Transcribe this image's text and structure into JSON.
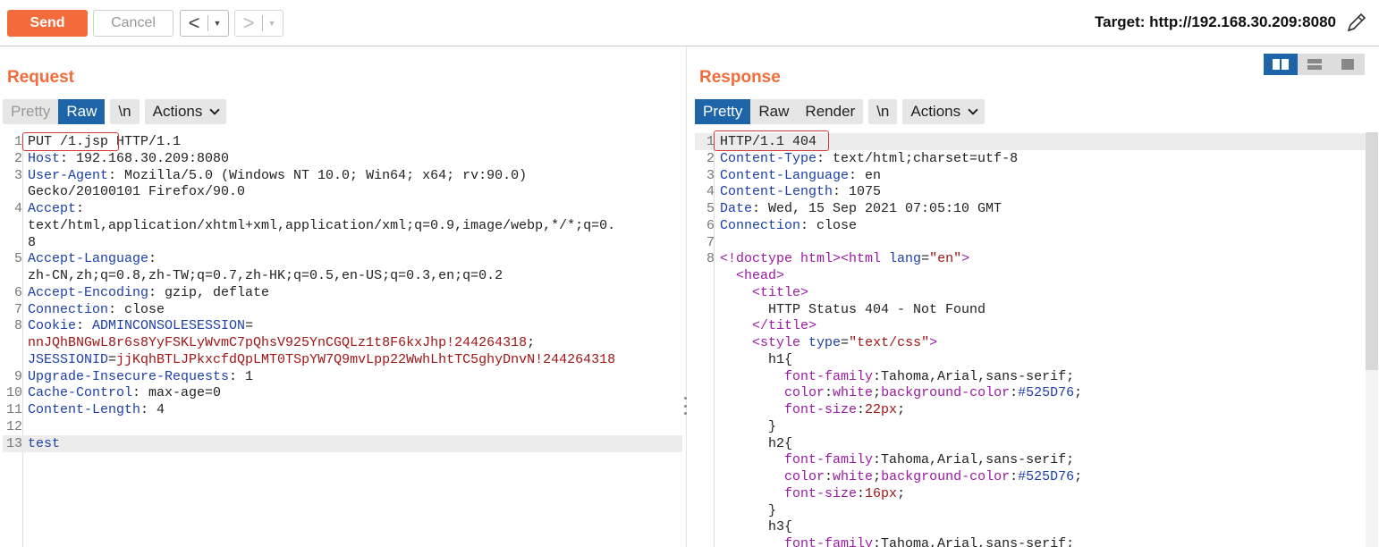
{
  "toolbar": {
    "send_label": "Send",
    "cancel_label": "Cancel",
    "back_glyph": "<",
    "forward_glyph": ">",
    "target_label": "Target: http://192.168.30.209:8080",
    "edit_icon": "pencil-icon"
  },
  "request": {
    "title": "Request",
    "view_tabs": [
      "Pretty",
      "Raw"
    ],
    "active_view": "Raw",
    "newline_toggle": "\\n",
    "actions_label": "Actions",
    "lines": [
      {
        "n": "1",
        "parts": [
          [
            "v",
            "PUT /1.jsp"
          ],
          [
            "v",
            " HTTP/1.1"
          ]
        ]
      },
      {
        "n": "2",
        "parts": [
          [
            "k",
            "Host"
          ],
          [
            "v",
            ": 192.168.30.209:8080"
          ]
        ]
      },
      {
        "n": "3",
        "parts": [
          [
            "k",
            "User-Agent"
          ],
          [
            "v",
            ": Mozilla/5.0 (Windows NT 10.0; Win64; x64; rv:90.0)"
          ]
        ]
      },
      {
        "n": "",
        "parts": [
          [
            "v",
            "Gecko/20100101 Firefox/90.0"
          ]
        ]
      },
      {
        "n": "4",
        "parts": [
          [
            "k",
            "Accept"
          ],
          [
            "v",
            ":"
          ]
        ]
      },
      {
        "n": "",
        "parts": [
          [
            "v",
            "text/html,application/xhtml+xml,application/xml;q=0.9,image/webp,*/*;q=0."
          ]
        ]
      },
      {
        "n": "",
        "parts": [
          [
            "v",
            "8"
          ]
        ]
      },
      {
        "n": "5",
        "parts": [
          [
            "k",
            "Accept-Language"
          ],
          [
            "v",
            ":"
          ]
        ]
      },
      {
        "n": "",
        "parts": [
          [
            "v",
            "zh-CN,zh;q=0.8,zh-TW;q=0.7,zh-HK;q=0.5,en-US;q=0.3,en;q=0.2"
          ]
        ]
      },
      {
        "n": "6",
        "parts": [
          [
            "k",
            "Accept-Encoding"
          ],
          [
            "v",
            ": gzip, deflate"
          ]
        ]
      },
      {
        "n": "7",
        "parts": [
          [
            "k",
            "Connection"
          ],
          [
            "v",
            ": close"
          ]
        ]
      },
      {
        "n": "8",
        "parts": [
          [
            "k",
            "Cookie"
          ],
          [
            "v",
            ": "
          ],
          [
            "k",
            "ADMINCONSOLESESSION"
          ],
          [
            "v",
            "="
          ]
        ]
      },
      {
        "n": "",
        "parts": [
          [
            "r",
            "nnJQhBNGwL8r6s8YyFSKLyWvmC7pQhsV925YnCGQLz1t8F6kxJhp!244264318"
          ],
          [
            "v",
            ";"
          ]
        ]
      },
      {
        "n": "",
        "parts": [
          [
            "k",
            "JSESSIONID"
          ],
          [
            "v",
            "="
          ],
          [
            "r",
            "jjKqhBTLJPkxcfdQpLMT0TSpYW7Q9mvLpp22WwhLhtTC5ghyDnvN!244264318"
          ]
        ]
      },
      {
        "n": "9",
        "parts": [
          [
            "k",
            "Upgrade-Insecure-Requests"
          ],
          [
            "v",
            ": 1"
          ]
        ]
      },
      {
        "n": "10",
        "parts": [
          [
            "k",
            "Cache-Control"
          ],
          [
            "v",
            ": max-age=0"
          ]
        ]
      },
      {
        "n": "11",
        "parts": [
          [
            "k",
            "Content-Length"
          ],
          [
            "v",
            ": 4"
          ]
        ]
      },
      {
        "n": "12",
        "parts": []
      },
      {
        "n": "13",
        "parts": [
          [
            "k",
            "test"
          ]
        ],
        "highlight": true
      }
    ]
  },
  "response": {
    "title": "Response",
    "view_tabs": [
      "Pretty",
      "Raw",
      "Render"
    ],
    "active_view": "Pretty",
    "newline_toggle": "\\n",
    "actions_label": "Actions",
    "lines": [
      {
        "n": "1",
        "parts": [
          [
            "v",
            "HTTP/1.1 404"
          ]
        ],
        "highlight": true
      },
      {
        "n": "2",
        "parts": [
          [
            "k",
            "Content-Type"
          ],
          [
            "v",
            ": text/html;charset=utf-8"
          ]
        ]
      },
      {
        "n": "3",
        "parts": [
          [
            "k",
            "Content-Language"
          ],
          [
            "v",
            ": en"
          ]
        ]
      },
      {
        "n": "4",
        "parts": [
          [
            "k",
            "Content-Length"
          ],
          [
            "v",
            ": 1075"
          ]
        ]
      },
      {
        "n": "5",
        "parts": [
          [
            "k",
            "Date"
          ],
          [
            "v",
            ": Wed, 15 Sep 2021 07:05:10 GMT"
          ]
        ]
      },
      {
        "n": "6",
        "parts": [
          [
            "k",
            "Connection"
          ],
          [
            "v",
            ": close"
          ]
        ]
      },
      {
        "n": "7",
        "parts": []
      },
      {
        "n": "8",
        "parts": [
          [
            "pu",
            "<!doctype html>"
          ],
          [
            "pu",
            "<html "
          ],
          [
            "k",
            "lang"
          ],
          [
            "v",
            "="
          ],
          [
            "r",
            "\"en\""
          ],
          [
            "pu",
            ">"
          ]
        ]
      },
      {
        "n": "",
        "parts": [
          [
            "v",
            "  "
          ],
          [
            "pu",
            "<head>"
          ]
        ]
      },
      {
        "n": "",
        "parts": [
          [
            "v",
            "    "
          ],
          [
            "pu",
            "<title>"
          ]
        ]
      },
      {
        "n": "",
        "parts": [
          [
            "v",
            "      HTTP Status 404 - Not Found"
          ]
        ]
      },
      {
        "n": "",
        "parts": [
          [
            "v",
            "    "
          ],
          [
            "pu",
            "</title>"
          ]
        ]
      },
      {
        "n": "",
        "parts": [
          [
            "v",
            "    "
          ],
          [
            "pu",
            "<style "
          ],
          [
            "k",
            "type"
          ],
          [
            "v",
            "="
          ],
          [
            "r",
            "\"text/css\""
          ],
          [
            "pu",
            ">"
          ]
        ]
      },
      {
        "n": "",
        "parts": [
          [
            "v",
            "      h1{"
          ]
        ]
      },
      {
        "n": "",
        "parts": [
          [
            "v",
            "        "
          ],
          [
            "pu",
            "font-family"
          ],
          [
            "v",
            ":Tahoma,Arial,sans-serif;"
          ]
        ]
      },
      {
        "n": "",
        "parts": [
          [
            "v",
            "        "
          ],
          [
            "pu",
            "color"
          ],
          [
            "v",
            ":"
          ],
          [
            "pu",
            "white"
          ],
          [
            "v",
            ";"
          ],
          [
            "pu",
            "background-color"
          ],
          [
            "v",
            ":"
          ],
          [
            "k",
            "#525D76"
          ],
          [
            "v",
            ";"
          ]
        ]
      },
      {
        "n": "",
        "parts": [
          [
            "v",
            "        "
          ],
          [
            "pu",
            "font-size"
          ],
          [
            "v",
            ":"
          ],
          [
            "r",
            "22px"
          ],
          [
            "v",
            ";"
          ]
        ]
      },
      {
        "n": "",
        "parts": [
          [
            "v",
            "      }"
          ]
        ]
      },
      {
        "n": "",
        "parts": [
          [
            "v",
            "      h2{"
          ]
        ]
      },
      {
        "n": "",
        "parts": [
          [
            "v",
            "        "
          ],
          [
            "pu",
            "font-family"
          ],
          [
            "v",
            ":Tahoma,Arial,sans-serif;"
          ]
        ]
      },
      {
        "n": "",
        "parts": [
          [
            "v",
            "        "
          ],
          [
            "pu",
            "color"
          ],
          [
            "v",
            ":"
          ],
          [
            "pu",
            "white"
          ],
          [
            "v",
            ";"
          ],
          [
            "pu",
            "background-color"
          ],
          [
            "v",
            ":"
          ],
          [
            "k",
            "#525D76"
          ],
          [
            "v",
            ";"
          ]
        ]
      },
      {
        "n": "",
        "parts": [
          [
            "v",
            "        "
          ],
          [
            "pu",
            "font-size"
          ],
          [
            "v",
            ":"
          ],
          [
            "r",
            "16px"
          ],
          [
            "v",
            ";"
          ]
        ]
      },
      {
        "n": "",
        "parts": [
          [
            "v",
            "      }"
          ]
        ]
      },
      {
        "n": "",
        "parts": [
          [
            "v",
            "      h3{"
          ]
        ]
      },
      {
        "n": "",
        "parts": [
          [
            "v",
            "        "
          ],
          [
            "pu",
            "font-family"
          ],
          [
            "v",
            ":Tahoma,Arial,sans-serif;"
          ]
        ]
      }
    ]
  },
  "colors": {
    "accent": "#f26b3a",
    "active_tab": "#1d64a8",
    "highlight_box": "#d43a3a"
  }
}
